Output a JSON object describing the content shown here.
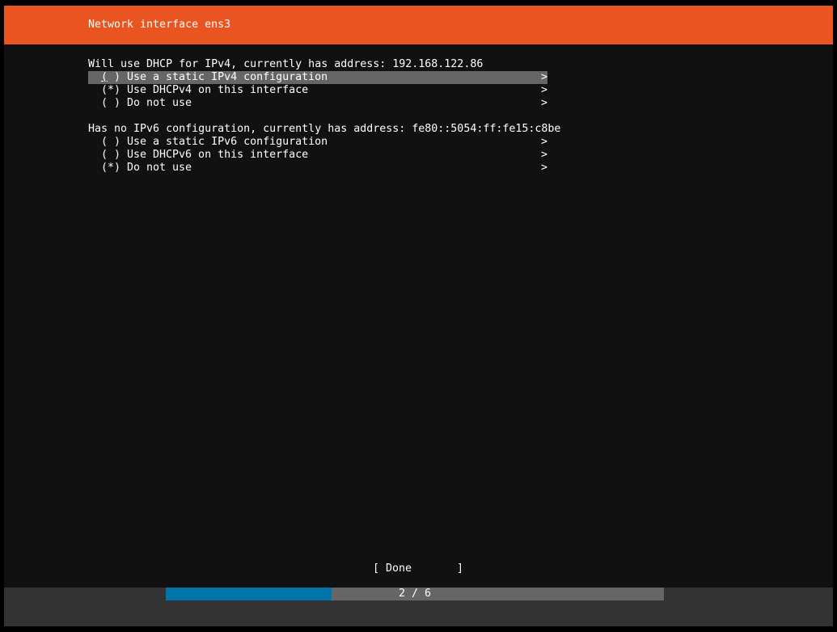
{
  "header": {
    "title": "Network interface ens3"
  },
  "ipv4": {
    "summary": "Will use DHCP for IPv4, currently has address: 192.168.122.86",
    "options": [
      {
        "radio": "( )",
        "label": "Use a static IPv4 configuration",
        "chevron": ">",
        "selected": true
      },
      {
        "radio": "(*)",
        "label": "Use DHCPv4 on this interface",
        "chevron": ">",
        "selected": false
      },
      {
        "radio": "( )",
        "label": "Do not use",
        "chevron": ">",
        "selected": false
      }
    ]
  },
  "ipv6": {
    "summary": "Has no IPv6 configuration, currently has address: fe80::5054:ff:fe15:c8be",
    "options": [
      {
        "radio": "( )",
        "label": "Use a static IPv6 configuration",
        "chevron": ">",
        "selected": false
      },
      {
        "radio": "( )",
        "label": "Use DHCPv6 on this interface",
        "chevron": ">",
        "selected": false
      },
      {
        "radio": "(*)",
        "label": "Do not use",
        "chevron": ">",
        "selected": false
      }
    ]
  },
  "done": {
    "bracket_left": "[",
    "label": "Done",
    "bracket_right": "]"
  },
  "progress": {
    "text": "2 / 6",
    "current": 2,
    "total": 6
  },
  "colors": {
    "header_bg": "#e95420",
    "body_bg": "#111111",
    "selected_bg": "#666666",
    "footer_bg": "#333333",
    "progress_fill": "#0073a8",
    "progress_track": "#666666"
  }
}
